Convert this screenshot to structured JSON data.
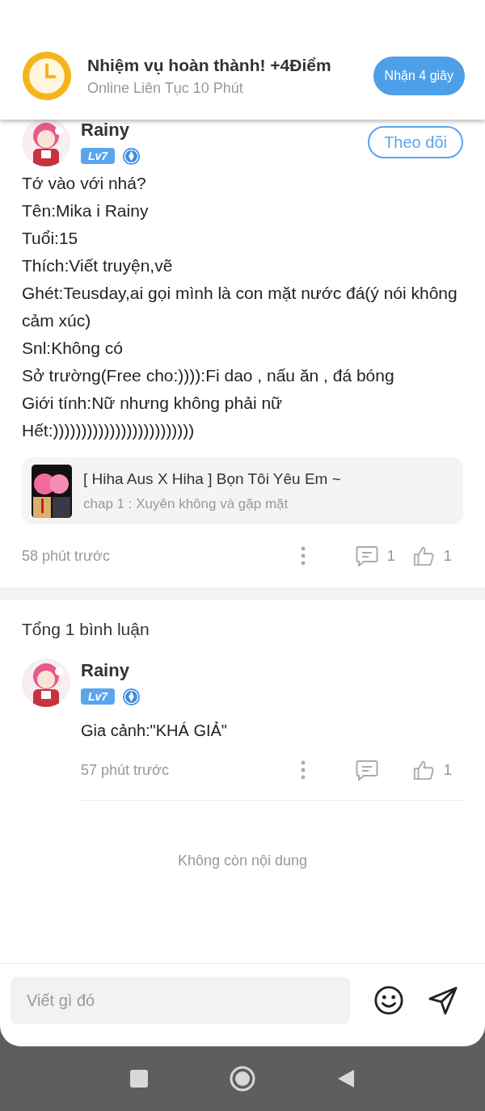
{
  "banner": {
    "title": "Nhiệm vụ hoàn thành! +4Điểm",
    "subtitle": "Online Liên Tục 10 Phút",
    "button": "Nhận 4 giây"
  },
  "post": {
    "author": "Rainy",
    "level": "Lv7",
    "follow": "Theo dõi",
    "lines": [
      "Tớ vào với nhá?",
      "Tên:Mika i Rainy",
      "Tuổi:15",
      "Thích:Viết truyện,vẽ",
      "Ghét:Teusday,ai gọi mình là con mặt nước đá(ý nói không cảm xúc)",
      "Snl:Không có",
      "Sở trường(Free cho:)))):Fi dao , nấu ăn , đá bóng",
      "Giới tính:Nữ nhưng không phải nữ",
      "Hết:)))))))))))))))))))))))))"
    ],
    "story": {
      "title": "[ Hiha Aus X Hiha ] Bọn Tôi Yêu Em ~",
      "chapter": "chap 1 : Xuyên không và gặp mặt"
    },
    "time": "58 phút trước",
    "comments": "1",
    "likes": "1"
  },
  "comments_header": "Tổng 1 bình luận",
  "comments": [
    {
      "author": "Rainy",
      "level": "Lv7",
      "text": "Gia cảnh:\"KHÁ GIẢ\"",
      "time": "57 phút trước",
      "likes": "1"
    }
  ],
  "end_text": "Không còn nội dung",
  "input": {
    "placeholder": "Viết gì đó"
  }
}
